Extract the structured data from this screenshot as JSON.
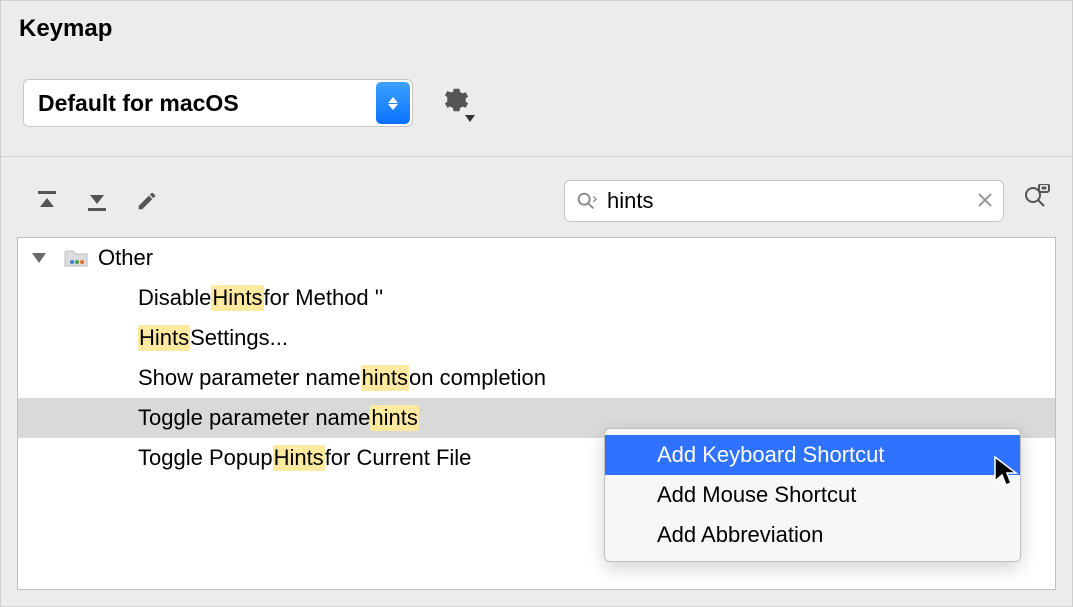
{
  "title": "Keymap",
  "scheme": {
    "selected": "Default for macOS"
  },
  "search": {
    "value": "hints"
  },
  "tree": {
    "group": "Other",
    "items": [
      {
        "pre": "Disable ",
        "hl": "Hints",
        "post": " for Method ''"
      },
      {
        "pre": "",
        "hl": "Hints",
        "post": " Settings..."
      },
      {
        "pre": "Show parameter name ",
        "hl": "hints",
        "post": " on completion"
      },
      {
        "pre": "Toggle parameter name ",
        "hl": "hints",
        "post": ""
      },
      {
        "pre": "Toggle Popup ",
        "hl": "Hints",
        "post": " for Current File"
      }
    ],
    "selected_index": 3
  },
  "menu": {
    "items": [
      "Add Keyboard Shortcut",
      "Add Mouse Shortcut",
      "Add Abbreviation"
    ],
    "highlight_index": 0
  }
}
